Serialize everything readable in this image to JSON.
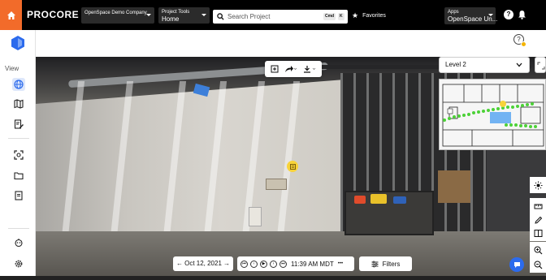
{
  "topbar": {
    "logo": "PROCORE",
    "company_select": {
      "main": "OpenSpace Demo Company"
    },
    "tools_select": {
      "caption": "Project Tools",
      "main": "Home"
    },
    "search": {
      "placeholder": "Search Project",
      "kbd1": "Cmd",
      "kbd2": "K"
    },
    "favorites": "Favorites",
    "apps_select": {
      "caption": "Apps",
      "main": "OpenSpace Un..."
    },
    "help": "?"
  },
  "sidebar": {
    "view_label": "View",
    "items": [
      {
        "icon": "globe-icon",
        "active": true
      },
      {
        "icon": "map-icon",
        "active": false
      },
      {
        "icon": "edit-doc-icon",
        "active": false
      },
      {
        "icon": "scan-icon",
        "active": false
      },
      {
        "icon": "folder-icon",
        "active": false
      },
      {
        "icon": "document-icon",
        "active": false
      },
      {
        "icon": "robot-icon",
        "active": false
      },
      {
        "icon": "gear-icon",
        "active": false
      }
    ]
  },
  "viewer": {
    "level": "Level 2",
    "date_nav": {
      "date": "Oct 12, 2021"
    },
    "time_ctrl": {
      "time": "11:39 AM MDT",
      "more": "•••"
    },
    "filters": "Filters"
  },
  "colors": {
    "topbar_bg": "#000000",
    "home_orange": "#f26b2a",
    "accent_blue": "#2c6bed",
    "annotation_yellow": "#f8d33a"
  }
}
